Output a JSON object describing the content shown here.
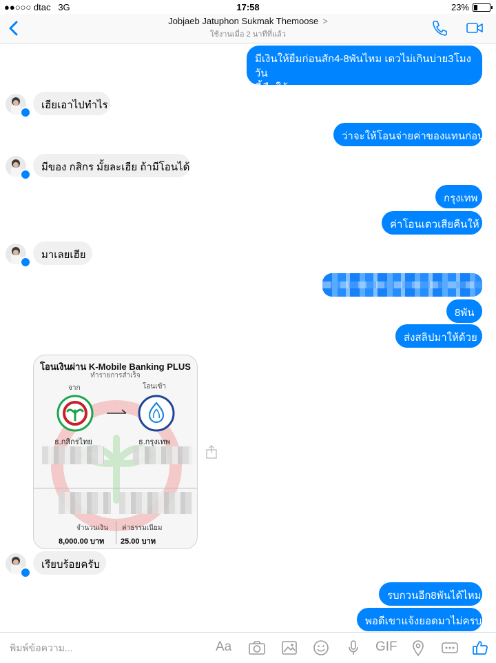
{
  "status": {
    "carrier": "dtac",
    "network": "3G",
    "time": "17:58",
    "battery": "23%",
    "battery_level": 0.23
  },
  "header": {
    "name": "Jobjaeb Jatuphon Sukmak Themoose",
    "activity": "ใช้งานเมื่อ 2 นาทีที่แล้ว"
  },
  "messages": {
    "m1": "มีเงินให้ยืมก่อนสัก4-8พันไหม เดวไม่เกินบ่าย3โมงวัน",
    "m1b": "นี้คืนให้",
    "m2": "เฮียเอาไปทำไร",
    "m3": "ว่าจะให้โอนจ่ายค่าของแทนก่อน",
    "m4": "มีของ กสิกร มั้ยละเฮีย ถ้ามีโอนได้",
    "m5": "กรุงเทพ",
    "m6": "ค่าโอนเดวเสียคืนให้",
    "m7": "มาเลยเฮีย",
    "m8": "8พัน",
    "m9": "ส่งสลิปมาให้ด้วย",
    "m10": "เรียบร้อยครับ",
    "m11": "รบกวนอีก8พันได้ไหม",
    "m12": "พอดีเขาแจ้งยอดมาไม่ครบ"
  },
  "receipt": {
    "title": "โอนเงินผ่าน K-Mobile Banking PLUS",
    "subtitle": "ทำรายการสำเร็จ",
    "from_label": "จาก",
    "to_label": "โอนเข้า",
    "from_bank": "ธ.กสิกรไทย",
    "to_bank": "ธ.กรุงเทพ",
    "amount_label": "จำนวนเงิน",
    "amount": "8,000.00 บาท",
    "fee_label": "ค่าธรรมเนียม",
    "fee": "25.00 บาท"
  },
  "composer": {
    "placeholder": "พิมพ์ข้อความ...",
    "aa": "Aa",
    "gif": "GIF"
  },
  "colors": {
    "accent": "#0084ff",
    "incoming": "#f1f0f0"
  },
  "icons": [
    "back-chevron-icon",
    "phone-icon",
    "video-camera-icon",
    "camera-icon",
    "photo-icon",
    "emoji-icon",
    "microphone-icon",
    "location-icon",
    "more-icon",
    "like-icon",
    "share-icon"
  ]
}
